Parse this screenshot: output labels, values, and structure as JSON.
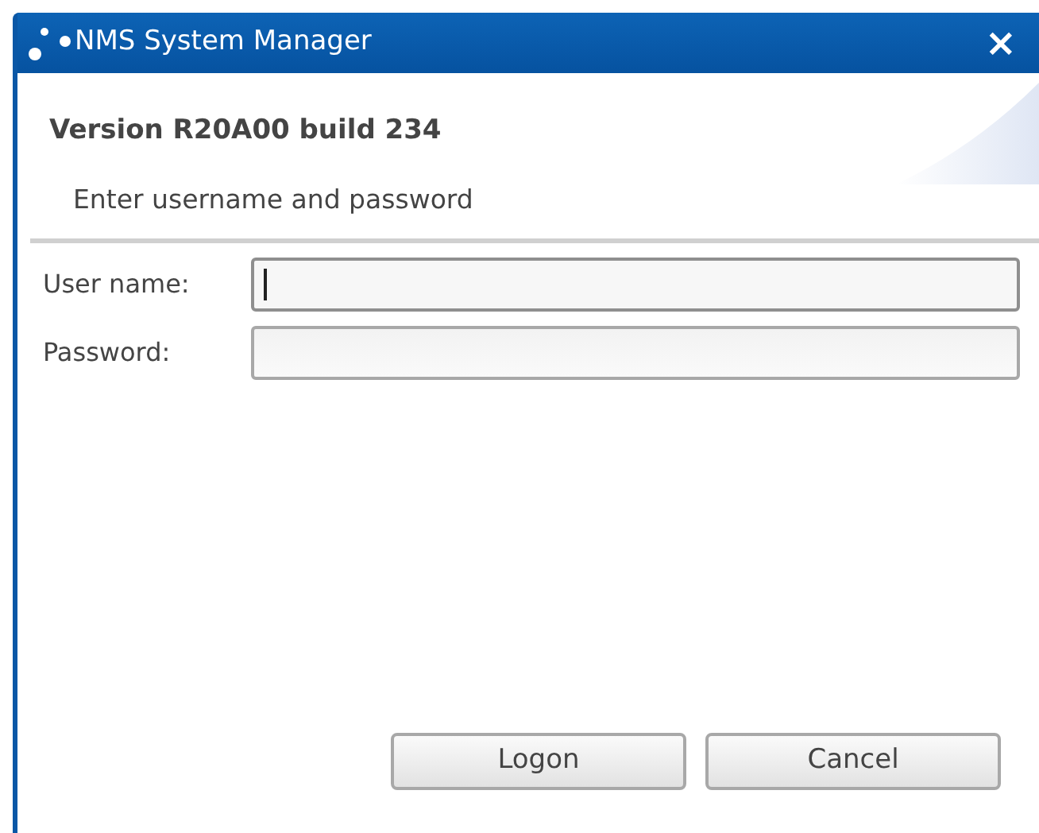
{
  "window": {
    "title": "NMS System Manager",
    "close": "×"
  },
  "version": "Version R20A00 build 234",
  "instruction": "Enter username and password",
  "fields": [
    {
      "label": "User name:",
      "focused": true
    },
    {
      "label": "Password:",
      "focused": false
    }
  ],
  "buttons": [
    "Logon",
    "Cancel"
  ]
}
